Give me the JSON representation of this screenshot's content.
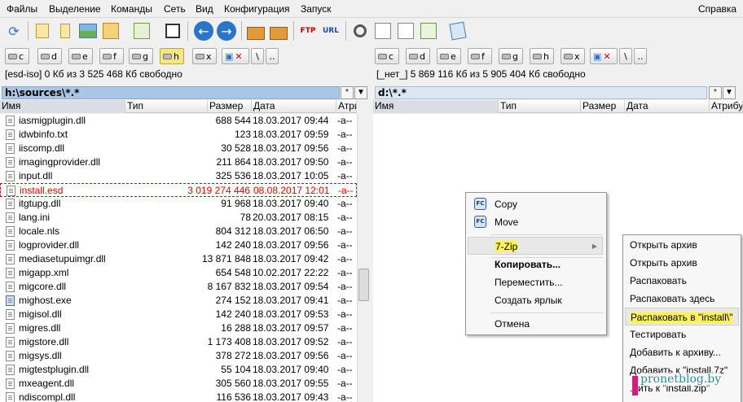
{
  "menu": [
    "Файлы",
    "Выделение",
    "Команды",
    "Сеть",
    "Вид",
    "Конфигурация",
    "Запуск"
  ],
  "menu_right": "Справка",
  "toolbar_icons": [
    "refresh-icon",
    "thumbnails-icon",
    "brief-view-icon",
    "image-view-icon",
    "tree-icon",
    "compare-icon",
    "quickview-icon",
    "back-arrow-icon",
    "forward-arrow-icon",
    "pack-icon",
    "unpack-icon",
    "ftp-icon",
    "url-icon",
    "search-icon",
    "multirename-icon",
    "sync-icon",
    "copy-names-icon",
    "notepad-icon"
  ],
  "toolbar_labels": {
    "ftp": "FTP",
    "url": "URL"
  },
  "left_drives": [
    "c",
    "d",
    "e",
    "f",
    "g",
    "h",
    "x",
    "\\",
    ".."
  ],
  "right_drives": [
    "c",
    "d",
    "e",
    "f",
    "g",
    "h",
    "x",
    "\\",
    ".."
  ],
  "left_info": "[esd-iso]  0 Кб из 3 525 468 Кб свободно",
  "right_info": "[_нет_]  5 869 116 Кб из 5 905 404 Кб свободно",
  "left_path": "h:\\sources\\*.*",
  "right_path": "d:\\*.*",
  "path_btn": "*",
  "path_btn2": "▼",
  "columns": [
    "Имя",
    "Тип",
    "Размер",
    "Дата",
    "Атрибуты"
  ],
  "right_columns": [
    "Имя",
    "Тип",
    "Размер",
    "Дата",
    "Атрибуты"
  ],
  "files": [
    {
      "name": "iasmigplugin.dll",
      "size": "688 544",
      "date": "18.03.2017 09:44",
      "attr": "-a--"
    },
    {
      "name": "idwbinfo.txt",
      "size": "123",
      "date": "18.03.2017 09:59",
      "attr": "-a--"
    },
    {
      "name": "iiscomp.dll",
      "size": "30 528",
      "date": "18.03.2017 09:56",
      "attr": "-a--"
    },
    {
      "name": "imagingprovider.dll",
      "size": "211 864",
      "date": "18.03.2017 09:50",
      "attr": "-a--"
    },
    {
      "name": "input.dll",
      "size": "325 536",
      "date": "18.03.2017 10:05",
      "attr": "-a--"
    },
    {
      "name": "install.esd",
      "size": "3 019 274 446",
      "date": "08.08.2017 12:01",
      "attr": "-a--",
      "selected": true
    },
    {
      "name": "itgtupg.dll",
      "size": "91 968",
      "date": "18.03.2017 09:40",
      "attr": "-a--"
    },
    {
      "name": "lang.ini",
      "size": "78",
      "date": "20.03.2017 08:15",
      "attr": "-a--"
    },
    {
      "name": "locale.nls",
      "size": "804 312",
      "date": "18.03.2017 06:50",
      "attr": "-a--"
    },
    {
      "name": "logprovider.dll",
      "size": "142 240",
      "date": "18.03.2017 09:56",
      "attr": "-a--"
    },
    {
      "name": "mediasetupuimgr.dll",
      "size": "13 871 848",
      "date": "18.03.2017 09:42",
      "attr": "-a--"
    },
    {
      "name": "migapp.xml",
      "size": "654 548",
      "date": "10.02.2017 22:22",
      "attr": "-a--"
    },
    {
      "name": "migcore.dll",
      "size": "8 167 832",
      "date": "18.03.2017 09:54",
      "attr": "-a--"
    },
    {
      "name": "mighost.exe",
      "size": "274 152",
      "date": "18.03.2017 09:41",
      "attr": "-a--",
      "exe": true
    },
    {
      "name": "migisol.dll",
      "size": "142 240",
      "date": "18.03.2017 09:53",
      "attr": "-a--"
    },
    {
      "name": "migres.dll",
      "size": "16 288",
      "date": "18.03.2017 09:57",
      "attr": "-a--"
    },
    {
      "name": "migstore.dll",
      "size": "1 173 408",
      "date": "18.03.2017 09:52",
      "attr": "-a--"
    },
    {
      "name": "migsys.dll",
      "size": "378 272",
      "date": "18.03.2017 09:56",
      "attr": "-a--"
    },
    {
      "name": "migtestplugin.dll",
      "size": "55 104",
      "date": "18.03.2017 09:40",
      "attr": "-a--"
    },
    {
      "name": "mxeagent.dll",
      "size": "305 560",
      "date": "18.03.2017 09:55",
      "attr": "-a--"
    },
    {
      "name": "ndiscompl.dll",
      "size": "116 536",
      "date": "18.03.2017 09:43",
      "attr": "-a--"
    }
  ],
  "context_menu": {
    "items": [
      "Copy",
      "Move",
      "7-Zip",
      "Копировать...",
      "Переместить...",
      "Создать ярлык",
      "Отмена"
    ],
    "fc_label": "FC",
    "arrow": "▶"
  },
  "submenu": {
    "items": [
      "Открыть архив",
      "Открыть архив",
      "Распаковать",
      "Распаковать здесь",
      "Распаковать в \"install\\\"",
      "Тестировать",
      "Добавить к архиву...",
      "Добавить к \"install.7z\"",
      "...ить к \"install.zip\""
    ]
  },
  "watermark": "pronetblog.by",
  "colors": {
    "accent": "#a9c6e6",
    "selected_text": "#e00000",
    "highlight": "#fff25c"
  }
}
